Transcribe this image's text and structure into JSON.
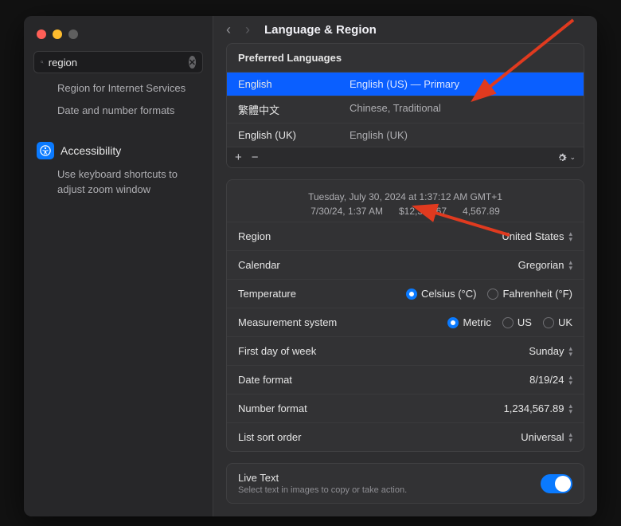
{
  "sidebar": {
    "search_value": "region",
    "results": [
      "Region for Internet Services",
      "Date and number formats"
    ],
    "accessibility_label": "Accessibility",
    "accessibility_sub": "Use keyboard shortcuts to adjust zoom window"
  },
  "header": {
    "title": "Language & Region"
  },
  "preferred_languages": {
    "heading": "Preferred Languages",
    "items": [
      {
        "name": "English",
        "desc": "English (US) — Primary",
        "selected": true
      },
      {
        "name": "繁體中文",
        "desc": "Chinese, Traditional",
        "selected": false
      },
      {
        "name": "English (UK)",
        "desc": "English (UK)",
        "selected": false
      }
    ]
  },
  "sample": {
    "line1": "Tuesday, July 30, 2024 at 1:37:12 AM GMT+1",
    "short_date": "7/30/24, 1:37 AM",
    "currency": "$12,345.67",
    "number": "4,567.89"
  },
  "settings": {
    "region": {
      "label": "Region",
      "value": "United States"
    },
    "calendar": {
      "label": "Calendar",
      "value": "Gregorian"
    },
    "temperature": {
      "label": "Temperature",
      "options": [
        {
          "label": "Celsius (°C)",
          "selected": true
        },
        {
          "label": "Fahrenheit (°F)",
          "selected": false
        }
      ]
    },
    "measurement": {
      "label": "Measurement system",
      "options": [
        {
          "label": "Metric",
          "selected": true
        },
        {
          "label": "US",
          "selected": false
        },
        {
          "label": "UK",
          "selected": false
        }
      ]
    },
    "first_day": {
      "label": "First day of week",
      "value": "Sunday"
    },
    "date_format": {
      "label": "Date format",
      "value": "8/19/24"
    },
    "number_format": {
      "label": "Number format",
      "value": "1,234,567.89"
    },
    "list_sort": {
      "label": "List sort order",
      "value": "Universal"
    }
  },
  "live_text": {
    "title": "Live Text",
    "subtitle": "Select text in images to copy or take action."
  }
}
